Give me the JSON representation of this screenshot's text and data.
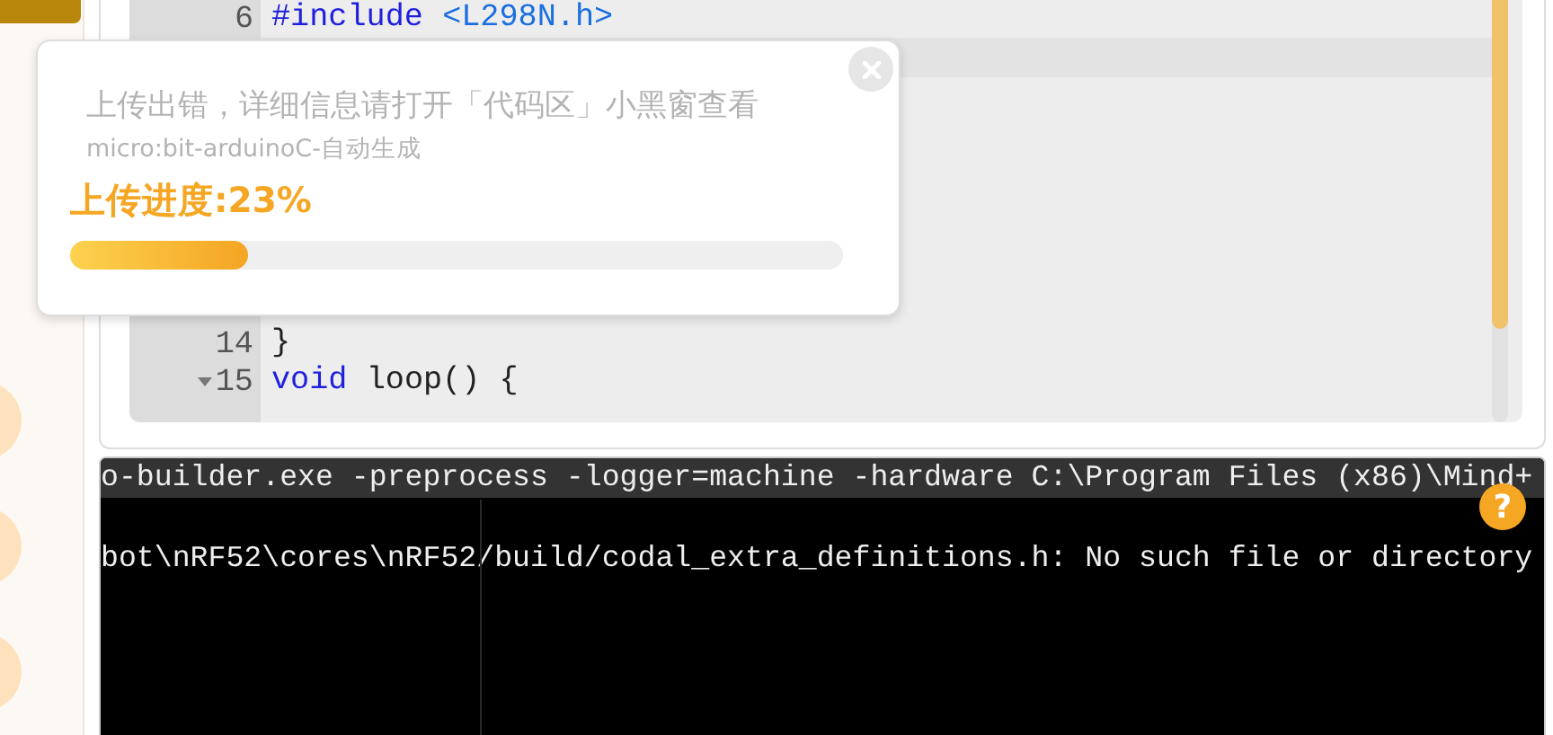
{
  "sidebar": {
    "circles": [
      {
        "kind": "circle"
      },
      {
        "kind": "circle"
      },
      {
        "kind": "circle"
      }
    ]
  },
  "editor": {
    "top_lines": [
      {
        "number": "6",
        "fold": false,
        "tokens": [
          {
            "kind": "keyword",
            "text": "#include"
          },
          {
            "kind": "include",
            "text": "<L298N.h>"
          }
        ]
      }
    ],
    "bottom_lines": [
      {
        "number": "14",
        "fold": false,
        "tokens": [
          {
            "kind": "plain",
            "text": "}"
          }
        ]
      },
      {
        "number": "15",
        "fold": true,
        "tokens": [
          {
            "kind": "keyword",
            "text": "void"
          },
          {
            "kind": "plain",
            "text": "loop() {"
          }
        ]
      }
    ]
  },
  "terminal": {
    "lines": [
      {
        "text": "o-builder.exe -preprocess -logger=machine -hardware C:\\Program Files (x86)\\Mind+",
        "highlighted": true
      },
      {
        "text": "bot\\nRF52\\cores\\nRF52/build/codal_extra_definitions.h: No such file or directory",
        "highlighted": false
      }
    ],
    "help_label": "?"
  },
  "upload_dialog": {
    "message": "上传出错，详细信息请打开「代码区」小黑窗查看",
    "subtitle": "micro:bit-arduinoC-自动生成",
    "progress_label": "上传进度:23%",
    "level": 0.23
  }
}
